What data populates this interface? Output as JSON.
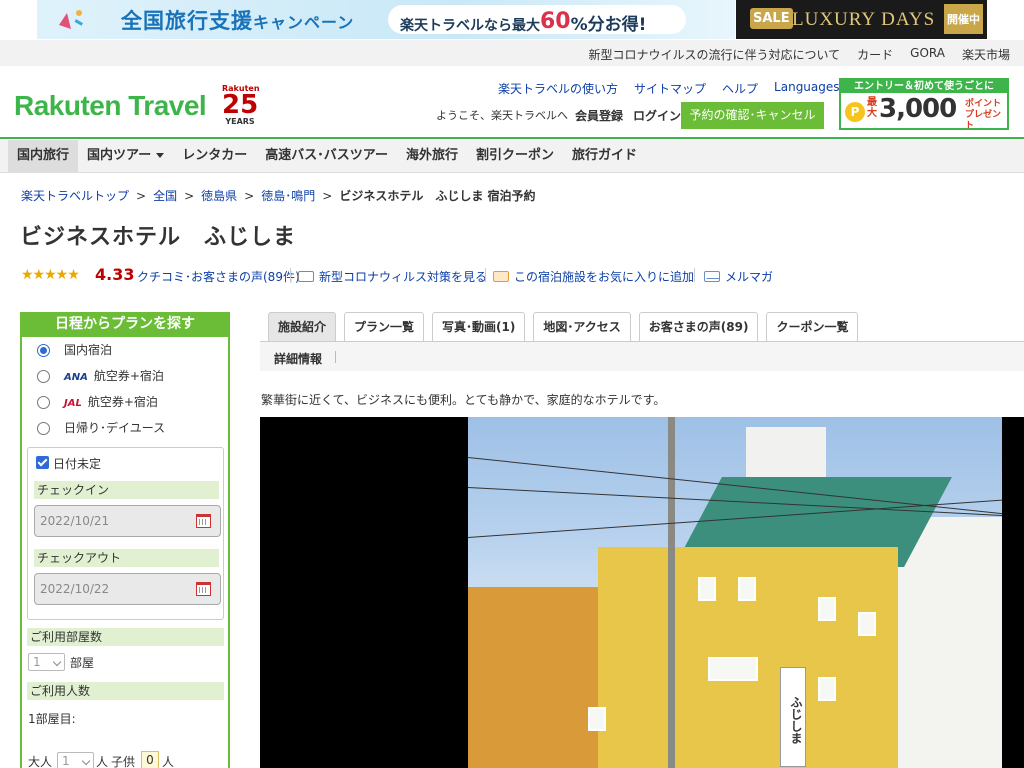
{
  "banner": {
    "campaign_title": "全国旅行支援",
    "campaign_suffix": "キャンペーン",
    "pill_prefix": "楽天トラベルなら最大",
    "pill_value": "60",
    "pill_suffix": "%分お得!",
    "sale_badge": "SALE",
    "luxury": "LUXURY DAYS",
    "luxury_status": "開催中"
  },
  "utility_links": [
    "新型コロナウイルスの流行に伴う対応について",
    "カード",
    "GORA",
    "楽天市場"
  ],
  "header": {
    "logo": "Rakuten Travel",
    "anniversary_brand": "Rakuten",
    "anniversary_num": "25",
    "anniversary_years": "YEARS",
    "links": [
      "楽天トラベルの使い方",
      "サイトマップ",
      "ヘルプ"
    ],
    "languages": "Languages",
    "welcome": "ようこそ、楽天トラベルへ",
    "member_register": "会員登録",
    "login": "ログイン",
    "reserve_button": "予約の確認･キャンセル",
    "entry_top": "エントリー＆初めて使うごとに",
    "entry_coin": "P",
    "entry_pre": "最大",
    "entry_amount": "3,000",
    "entry_points": "ポイント",
    "entry_present": "プレゼント"
  },
  "nav": [
    "国内旅行",
    "国内ツアー",
    "レンタカー",
    "高速バス･バスツアー",
    "海外旅行",
    "割引クーポン",
    "旅行ガイド"
  ],
  "breadcrumb": {
    "items": [
      "楽天トラベルトップ",
      "全国",
      "徳島県",
      "徳島･鳴門"
    ],
    "current": "ビジネスホテル　ふじしま 宿泊予約",
    "separator": ">"
  },
  "hotel": {
    "name": "ビジネスホテル　ふじしま",
    "stars": "★★★★★",
    "rating": 4.33,
    "rating_text": "4.33",
    "reviews_link": "クチコミ･お客さまの声(89件)",
    "covid_link": "新型コロナウィルス対策を見る",
    "favorite_link": "この宿泊施設をお気に入りに追加",
    "newsletter_link": "メルマガ",
    "description": "繁華街に近くて、ビジネスにも便利。とても静かで、家庭的なホテルです。",
    "photo_sign": "ふじしま"
  },
  "sidebar": {
    "title": "日程からプランを探す",
    "options": [
      {
        "airline": "",
        "label": "国内宿泊",
        "selected": true
      },
      {
        "airline": "ANA",
        "label": "航空券+宿泊",
        "selected": false
      },
      {
        "airline": "JAL",
        "label": "航空券+宿泊",
        "selected": false
      },
      {
        "airline": "",
        "label": "日帰り･デイユース",
        "selected": false
      }
    ],
    "date_undecided": "日付未定",
    "checkin_label": "チェックイン",
    "checkin_value": "2022/10/21",
    "checkout_label": "チェックアウト",
    "checkout_value": "2022/10/22",
    "rooms_label": "ご利用部屋数",
    "rooms_value": "1",
    "rooms_unit": "部屋",
    "people_label": "ご利用人数",
    "room1_label": "1部屋目:",
    "adult_label": "大人",
    "adult_value": "1",
    "adult_unit": "人",
    "child_label": "子供",
    "child_value": "0",
    "child_unit": "人"
  },
  "tabs": [
    "施設紹介",
    "プラン一覧",
    "写真･動画(1)",
    "地図･アクセス",
    "お客さまの声(89)",
    "クーポン一覧"
  ],
  "subtab": "詳細情報",
  "colors": {
    "brand_green": "#3db54a",
    "button_green": "#6bbd37",
    "rating_red": "#bf0000",
    "link_blue": "#0d3fa6"
  }
}
